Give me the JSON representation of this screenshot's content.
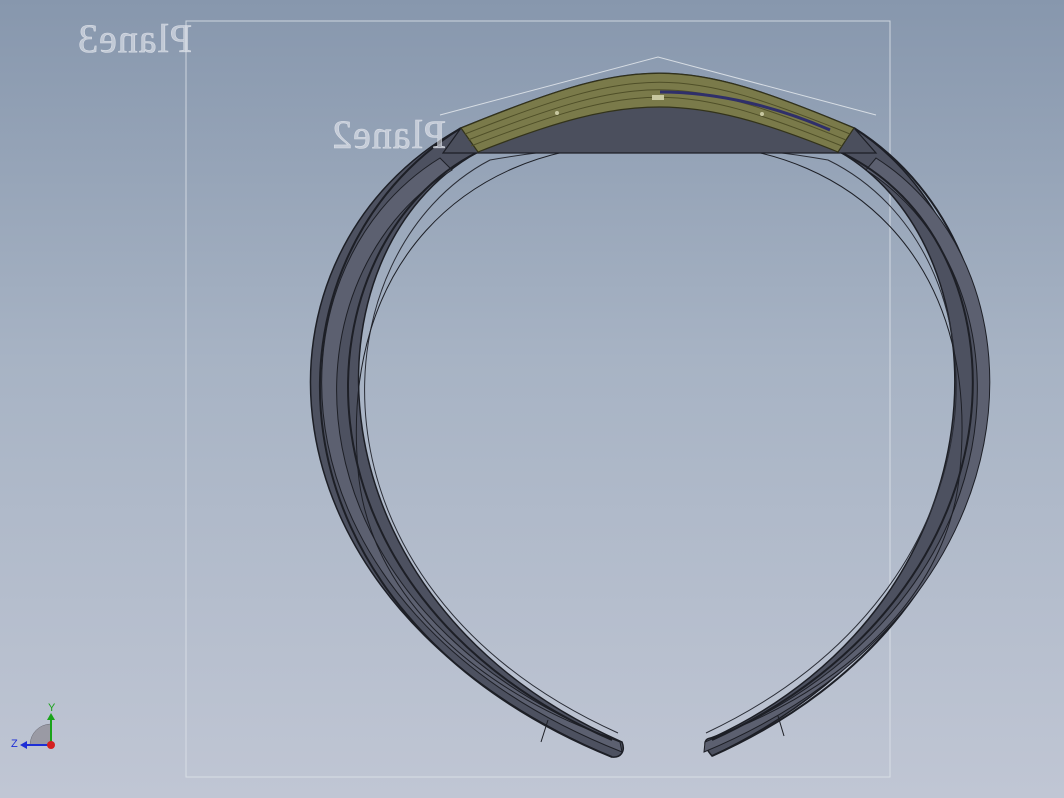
{
  "viewport": {
    "plane_labels": [
      "Plane3",
      "Plane2"
    ]
  },
  "triad": {
    "y_label": "Y",
    "z_label": "Z",
    "y_color": "#1aa31a",
    "z_color": "#1e2fd6",
    "x_color": "#d42020"
  },
  "colors": {
    "ring_body": "#4d5160",
    "ring_edge": "#1d1f26",
    "ring_inner_band": "#5c6070",
    "inlay": "#7a7a4a",
    "inlay_line": "#5a5a2e",
    "channel": "#2f2f6a",
    "plane_outline": "#dfe4ea"
  }
}
